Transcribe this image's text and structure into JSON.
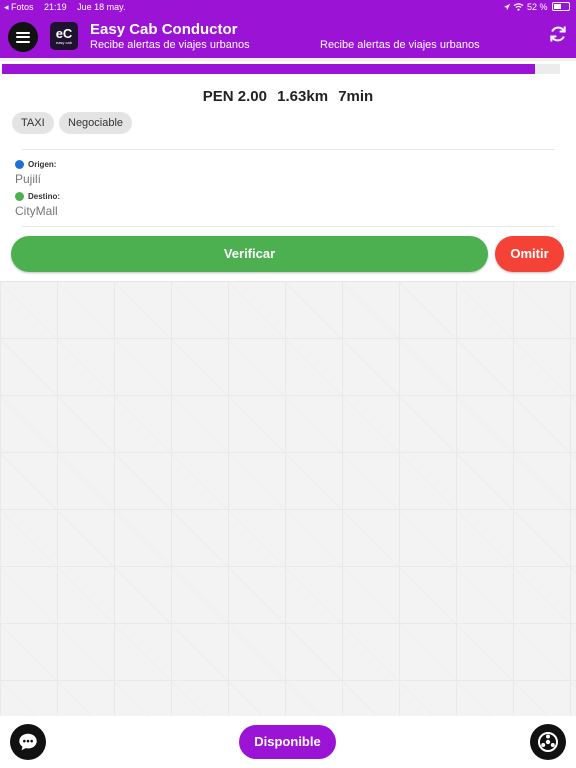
{
  "status_bar": {
    "back_app": "◂ Fotos",
    "time": "21:19",
    "date": "Jue 18 may.",
    "battery": "52 %"
  },
  "header": {
    "title": "Easy Cab Conductor",
    "subtitle": "Recibe alertas de viajes urbanos",
    "subtitle_secondary": "Recibe alertas de viajes urbanos",
    "logo_mark": "eC",
    "logo_text": "easy cab"
  },
  "ride_request": {
    "progress_fraction": 0.955,
    "fare": "PEN 2.00",
    "distance": "1.63km",
    "duration": "7min",
    "tags": [
      "TAXI",
      "Negociable"
    ],
    "origin_label": "Origen:",
    "origin_value": "Pujilí",
    "destination_label": "Destino:",
    "destination_value": "CityMall",
    "verify_label": "Verificar",
    "skip_label": "Omitir"
  },
  "bottom_bar": {
    "available_label": "Disponible"
  },
  "colors": {
    "brand": "#9b14d6",
    "verify": "#4caf50",
    "skip": "#f44336",
    "origin_dot": "#1e6fd9",
    "destination_dot": "#4caf50"
  }
}
